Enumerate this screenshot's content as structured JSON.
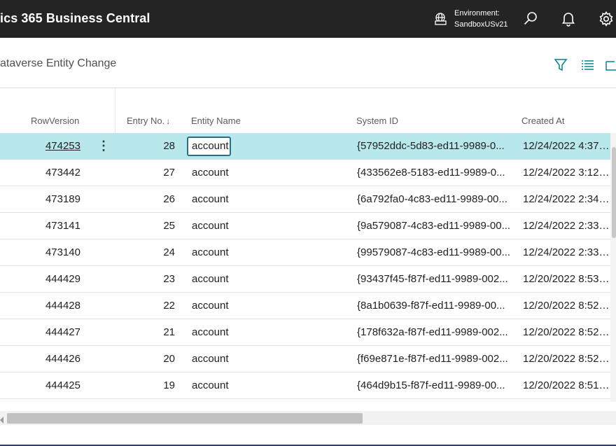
{
  "app": {
    "title": "ics 365 Business Central",
    "environment_label": "Environment:",
    "environment_name": "SandboxUSv21"
  },
  "page": {
    "title": "ataverse Entity Change"
  },
  "icons": {
    "environment": "globe-building-icon",
    "search": "search-icon",
    "notifications": "bell-icon",
    "settings": "gear-icon",
    "filter": "filter-icon",
    "list": "list-view-icon",
    "share": "open-in-icon",
    "row_actions": "more-vertical-icon"
  },
  "colors": {
    "topbar": "#242424",
    "selected_row": "#b9e8ec",
    "focus_border": "#2f6e7e",
    "accent": "#00828f"
  },
  "grid": {
    "columns": {
      "row_version": "RowVersion",
      "entry_no": "Entry No.",
      "entry_no_sort": "↓",
      "entity_name": "Entity Name",
      "system_id": "System ID",
      "created_at": "Created At"
    },
    "rows": [
      {
        "row_version": "474253",
        "entry_no": "28",
        "entity_name": "account",
        "system_id": "{57952ddc-5d83-ed11-9989-0...",
        "created_at": "12/24/2022 4:37 ..."
      },
      {
        "row_version": "473442",
        "entry_no": "27",
        "entity_name": "account",
        "system_id": "{433562e8-5183-ed11-9989-0...",
        "created_at": "12/24/2022 3:12 ..."
      },
      {
        "row_version": "473189",
        "entry_no": "26",
        "entity_name": "account",
        "system_id": "{6a792fa0-4c83-ed11-9989-00...",
        "created_at": "12/24/2022 2:34 ..."
      },
      {
        "row_version": "473141",
        "entry_no": "25",
        "entity_name": "account",
        "system_id": "{9a579087-4c83-ed11-9989-00...",
        "created_at": "12/24/2022 2:33 ..."
      },
      {
        "row_version": "473140",
        "entry_no": "24",
        "entity_name": "account",
        "system_id": "{99579087-4c83-ed11-9989-00...",
        "created_at": "12/24/2022 2:33 ..."
      },
      {
        "row_version": "444429",
        "entry_no": "23",
        "entity_name": "account",
        "system_id": "{93437f45-f87f-ed11-9989-002...",
        "created_at": "12/20/2022 8:53 ..."
      },
      {
        "row_version": "444428",
        "entry_no": "22",
        "entity_name": "account",
        "system_id": "{8a1b0639-f87f-ed11-9989-00...",
        "created_at": "12/20/2022 8:52 ..."
      },
      {
        "row_version": "444427",
        "entry_no": "21",
        "entity_name": "account",
        "system_id": "{178f632a-f87f-ed11-9989-002...",
        "created_at": "12/20/2022 8:52 ..."
      },
      {
        "row_version": "444426",
        "entry_no": "20",
        "entity_name": "account",
        "system_id": "{f69e871e-f87f-ed11-9989-002...",
        "created_at": "12/20/2022 8:52 ..."
      },
      {
        "row_version": "444425",
        "entry_no": "19",
        "entity_name": "account",
        "system_id": "{464d9b15-f87f-ed11-9989-00...",
        "created_at": "12/20/2022 8:51 ..."
      }
    ]
  }
}
